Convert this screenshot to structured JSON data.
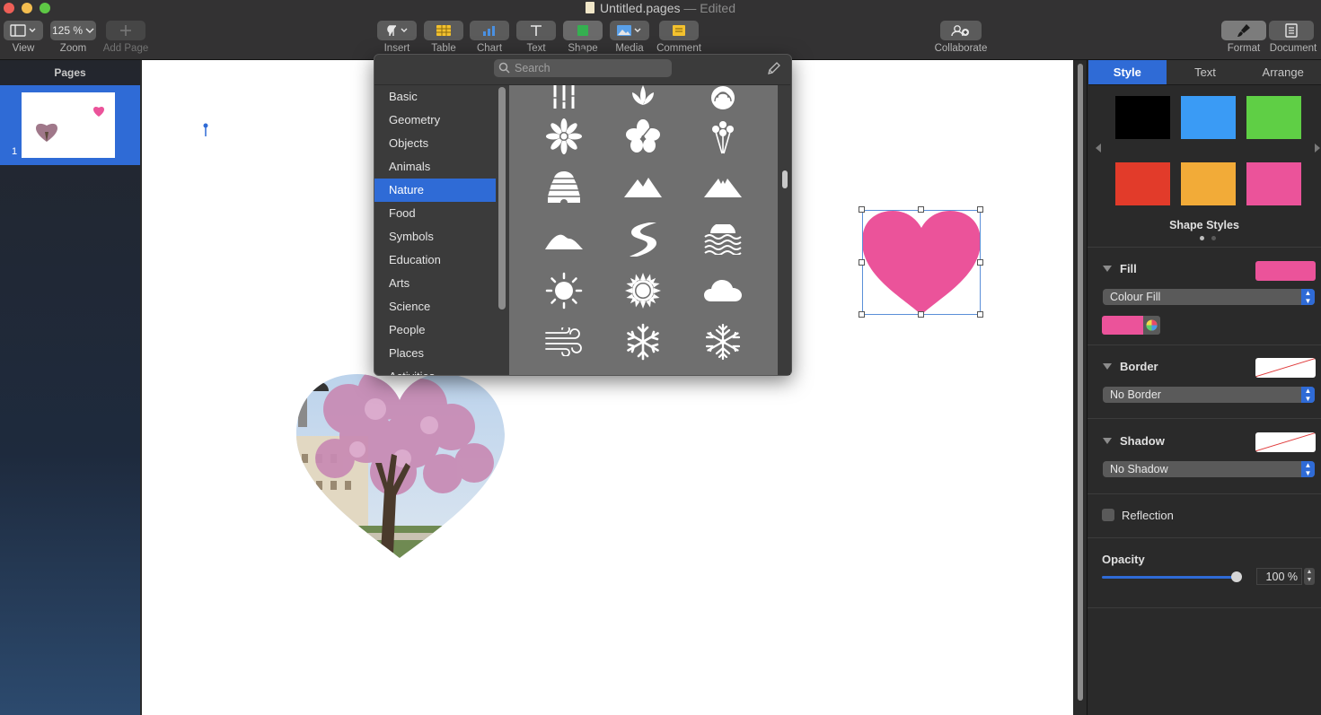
{
  "window": {
    "title": "Untitled.pages",
    "subtitle": "— Edited"
  },
  "toolbar": {
    "view_label": "View",
    "zoom_value": "125 %",
    "zoom_label": "Zoom",
    "add_page_label": "Add Page",
    "insert_label": "Insert",
    "table_label": "Table",
    "chart_label": "Chart",
    "text_label": "Text",
    "shape_label": "Shape",
    "media_label": "Media",
    "comment_label": "Comment",
    "collaborate_label": "Collaborate",
    "format_label": "Format",
    "document_label": "Document"
  },
  "sidebar": {
    "title": "Pages",
    "page_number": "1"
  },
  "shape_library": {
    "search_placeholder": "Search",
    "categories": [
      "Basic",
      "Geometry",
      "Objects",
      "Animals",
      "Nature",
      "Food",
      "Symbols",
      "Education",
      "Arts",
      "Science",
      "People",
      "Places",
      "Activities"
    ],
    "selected_category": "Nature",
    "visible_shapes": [
      "bamboo",
      "lotus",
      "rose",
      "daisy",
      "hibiscus",
      "bouquet",
      "beehive",
      "mountains",
      "volcano",
      "hill",
      "river",
      "waves",
      "sun",
      "sunburst",
      "cloud",
      "wind",
      "snowflake",
      "snowflake-ornate"
    ]
  },
  "inspector": {
    "tabs": [
      "Style",
      "Text",
      "Arrange"
    ],
    "active_tab": "Style",
    "swatch_colors": [
      "#000000",
      "#3a9bf5",
      "#5fcf45",
      "#e23b2a",
      "#f2ab38",
      "#eb539a"
    ],
    "shape_styles_label": "Shape Styles",
    "fill": {
      "title": "Fill",
      "type": "Colour Fill",
      "color": "#eb539a"
    },
    "border": {
      "title": "Border",
      "type": "No Border"
    },
    "shadow": {
      "title": "Shadow",
      "type": "No Shadow"
    },
    "reflection": {
      "label": "Reflection",
      "checked": false
    },
    "opacity": {
      "title": "Opacity",
      "value": "100 %",
      "level": 1.0
    }
  },
  "canvas": {
    "selected_shape": "heart",
    "selected_fill": "#eb539a"
  }
}
